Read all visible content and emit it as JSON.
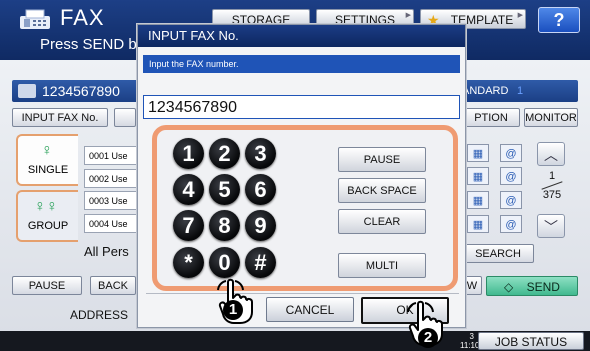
{
  "app": {
    "title": "FAX",
    "subtitle": "Press SEND bu",
    "top_buttons": [
      {
        "label": "STORAGE"
      },
      {
        "label": "SETTINGS"
      },
      {
        "label": "TEMPLATE"
      }
    ],
    "help_label": "?",
    "destination_number": "1234567890",
    "standard_label": "ANDARD",
    "copies_label": "1",
    "input_fax_button": "INPUT FAX No.",
    "option_button": "PTION",
    "monitor_button": "MONITOR",
    "tabs": [
      {
        "label": "SINGLE"
      },
      {
        "label": "GROUP"
      }
    ],
    "list_rows": [
      "0001 Use",
      "0002 Use",
      "0003 Use",
      "0004 Use"
    ],
    "all_persons": "All Pers",
    "page_current": "1",
    "page_total": "375",
    "search_button": "SEARCH",
    "pause_button": "PAUSE",
    "back_button": "BACK",
    "address_label": "ADDRESS",
    "w_button": "W",
    "send_button": "SEND",
    "clock": {
      "line1": "3",
      "line2": "11:10"
    },
    "job_status": "JOB STATUS"
  },
  "modal": {
    "title": "INPUT FAX No.",
    "instruction": "Input the FAX number.",
    "fax_value": "1234567890",
    "keys": [
      "1",
      "2",
      "3",
      "4",
      "5",
      "6",
      "7",
      "8",
      "9",
      "*",
      "0",
      "#"
    ],
    "function_buttons": [
      "PAUSE",
      "BACK SPACE",
      "CLEAR",
      "MULTI"
    ],
    "cancel_label": "CANCEL",
    "ok_label": "OK"
  },
  "annotations": {
    "step1": "1",
    "step2": "2"
  },
  "colors": {
    "title_bar": "#0f2a63",
    "accent_blue": "#1f54b7",
    "keypad_frame": "#ef9b72",
    "send_green": "#41b98f"
  }
}
